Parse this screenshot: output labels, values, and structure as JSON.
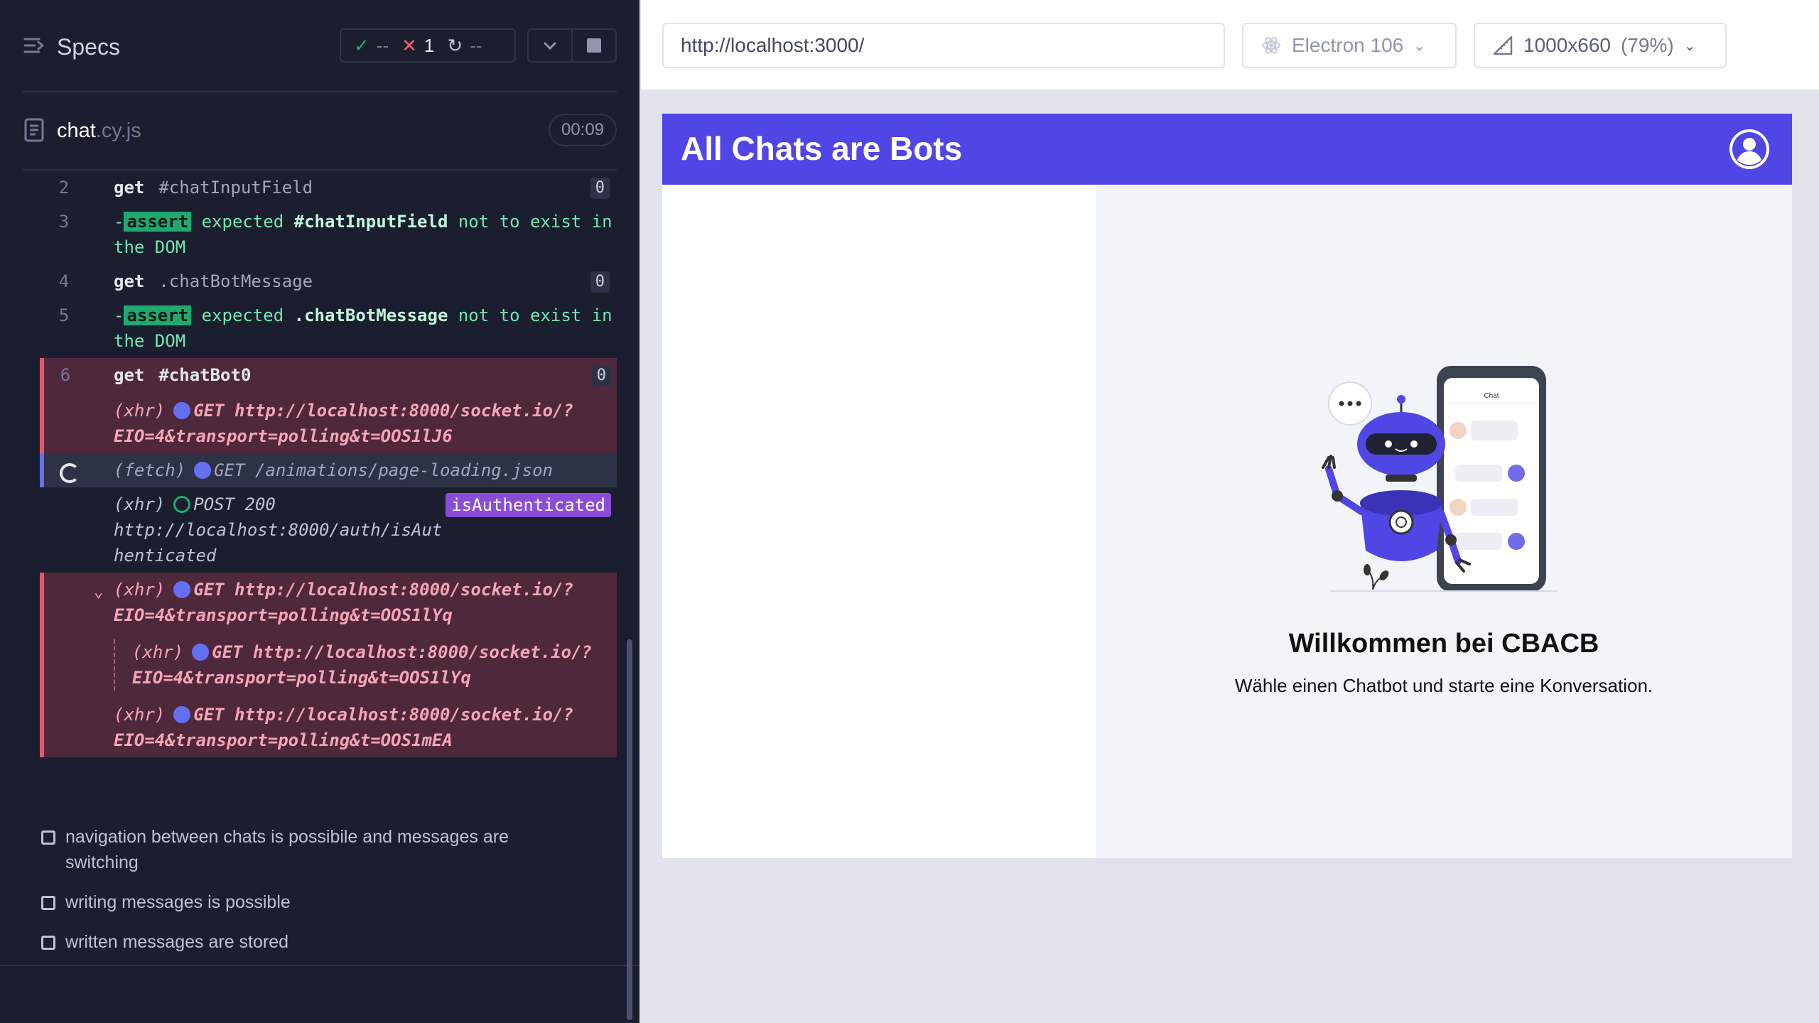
{
  "reporter": {
    "specs_label": "Specs",
    "stats": {
      "passed": "--",
      "failed": "1",
      "pending": "--"
    },
    "file": {
      "name": "chat",
      "ext": ".cy.js",
      "duration": "00:09"
    },
    "commands": [
      {
        "num": "2",
        "kw": "get",
        "text": "#chatInputField",
        "count": "0"
      },
      {
        "num": "3",
        "prefix": "-",
        "badge": "assert",
        "parts": [
          "expected ",
          "#chatInputField",
          " not to exist in the DOM"
        ]
      },
      {
        "num": "4",
        "kw": "get",
        "text": ".chatBotMessage",
        "count": "0"
      },
      {
        "num": "5",
        "prefix": "-",
        "badge": "assert",
        "parts": [
          "expected ",
          ".chatBotMessage",
          " not to exist in the DOM"
        ]
      },
      {
        "num": "6",
        "kw": "get",
        "text": "#chatBot0",
        "count": "0"
      }
    ],
    "requests": [
      {
        "type": "(xhr)",
        "text": "GET http://localhost:8000/socket.io/?EIO=4&transport=polling&t=OOS1lJ6"
      },
      {
        "type": "(fetch)",
        "text": "GET /animations/page-loading.json"
      },
      {
        "type": "(xhr)",
        "text": "POST 200",
        "url": "http://localhost:8000/auth/isAuthenticated",
        "alias": "isAuthenticated"
      },
      {
        "type": "(xhr)",
        "text": "GET http://localhost:8000/socket.io/?EIO=4&transport=polling&t=OOS1lYq"
      },
      {
        "type": "(xhr)",
        "text": "GET http://localhost:8000/socket.io/?EIO=4&transport=polling&t=OOS1lYq"
      },
      {
        "type": "(xhr)",
        "text": "GET http://localhost:8000/socket.io/?EIO=4&transport=polling&t=OOS1mEA"
      }
    ],
    "tests": [
      "navigation between chats is possibile and messages are switching",
      "writing messages is possible",
      "written messages are stored"
    ]
  },
  "browser": {
    "url": "http://localhost:3000/",
    "browser_name": "Electron 106",
    "viewport": "1000x660",
    "zoom": "(79%)"
  },
  "app": {
    "title": "All Chats are Bots",
    "welcome_title": "Willkommen bei CBACB",
    "welcome_sub": "Wähle einen Chatbot und starte eine Konversation.",
    "illustration_label": "Chat"
  },
  "colors": {
    "reporter_bg": "#1b1e2e",
    "app_header": "#4f46e5",
    "failed_row": "#50283c",
    "assert_green": "#1fa971",
    "alias_purple": "#8a4dd6"
  }
}
